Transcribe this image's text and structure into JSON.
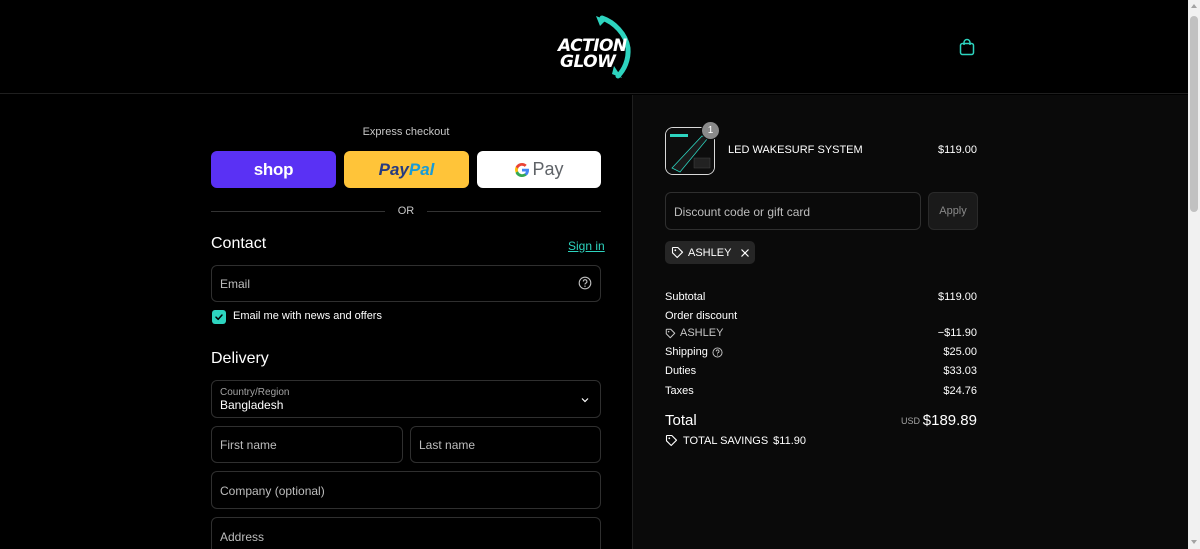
{
  "header": {
    "logo_line1": "ACTION",
    "logo_line2": "GLOW",
    "icons": {
      "cart": "shopping-bag-icon"
    },
    "accent_color": "#2dd4bf"
  },
  "express": {
    "label": "Express checkout",
    "shop_label": "shop",
    "paypal_part1": "Pay",
    "paypal_part2": "Pal",
    "gpay_label": "Pay",
    "or_label": "OR"
  },
  "contact": {
    "title": "Contact",
    "sign_in": "Sign in",
    "email_placeholder": "Email",
    "newsletter_label": "Email me with news and offers",
    "newsletter_checked": true
  },
  "delivery": {
    "title": "Delivery",
    "country_label": "Country/Region",
    "country_value": "Bangladesh",
    "first_name_placeholder": "First name",
    "last_name_placeholder": "Last name",
    "company_placeholder": "Company (optional)",
    "address_placeholder": "Address"
  },
  "order": {
    "item": {
      "name": "LED WAKESURF SYSTEM",
      "price": "$119.00",
      "quantity": "1"
    },
    "discount_placeholder": "Discount code or gift card",
    "apply_label": "Apply",
    "applied_code": "ASHLEY",
    "summary": {
      "subtotal_label": "Subtotal",
      "subtotal_value": "$119.00",
      "order_discount_label": "Order discount",
      "discount_code": "ASHLEY",
      "discount_value": "−$11.90",
      "shipping_label": "Shipping",
      "shipping_value": "$25.00",
      "duties_label": "Duties",
      "duties_value": "$33.03",
      "taxes_label": "Taxes",
      "taxes_value": "$24.76",
      "total_label": "Total",
      "currency": "USD",
      "total_value": "$189.89",
      "savings_label": "TOTAL SAVINGS",
      "savings_value": "$11.90"
    }
  }
}
